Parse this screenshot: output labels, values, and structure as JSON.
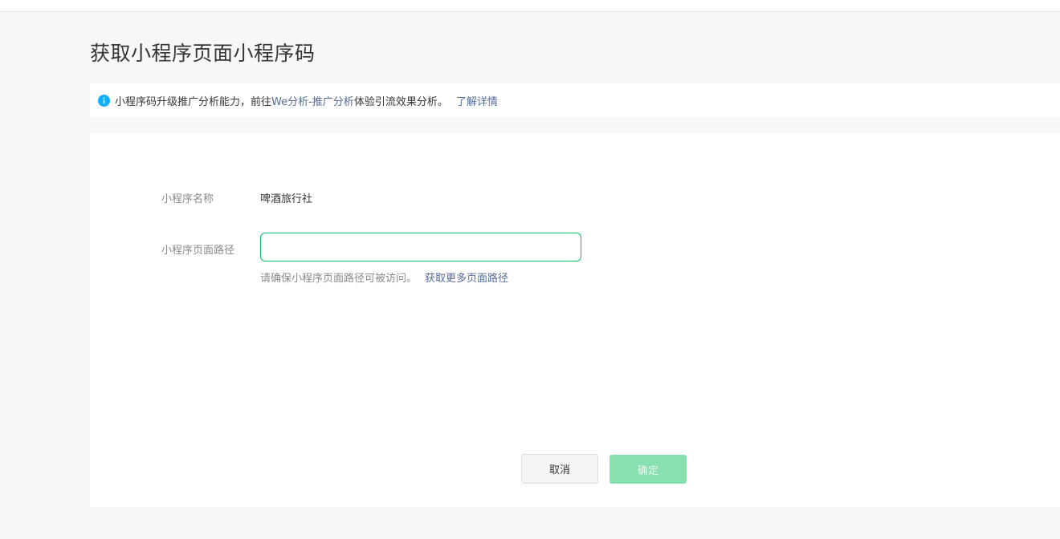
{
  "page": {
    "title": "获取小程序页面小程序码"
  },
  "notice": {
    "icon": "info-icon",
    "text_before": "小程序码升级推广分析能力，前往",
    "link_text": "We分析-推广分析",
    "text_after": "体验引流效果分析。",
    "learn_more": "了解详情"
  },
  "form": {
    "name_label": "小程序名称",
    "name_value": "啤酒旅行社",
    "path_label": "小程序页面路径",
    "path_value": "",
    "tip_text": "请确保小程序页面路径可被访问。",
    "tip_link": "获取更多页面路径"
  },
  "buttons": {
    "cancel": "取消",
    "confirm": "确定"
  },
  "colors": {
    "accent": "#07c160",
    "link": "#576b95",
    "info": "#10aeff",
    "disabled_primary": "#88e0b1"
  }
}
